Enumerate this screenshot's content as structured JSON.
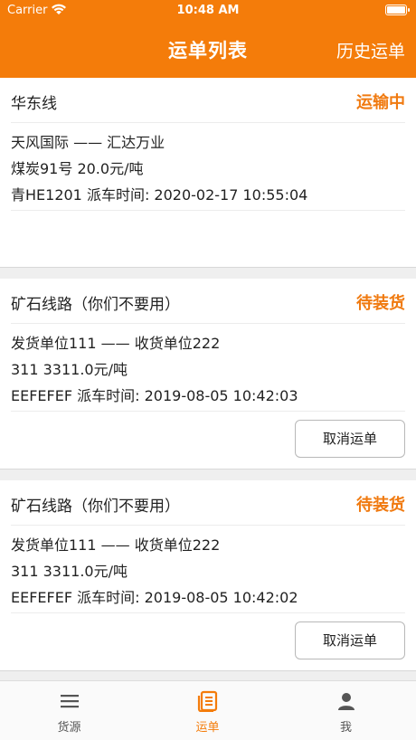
{
  "status_bar": {
    "carrier": "Carrier",
    "time": "10:48 AM"
  },
  "nav": {
    "title": "运单列表",
    "right_action": "历史运单"
  },
  "orders": [
    {
      "route": "华东线",
      "status": "运输中",
      "parties": "天风国际 —— 汇达万业",
      "cargo": "煤炭91号  20.0元/吨",
      "dispatch": "青HE1201  派车时间: 2020-02-17 10:55:04"
    },
    {
      "route": "矿石线路（你们不要用）",
      "status": "待装货",
      "parties": "发货单位111 —— 收货单位222",
      "cargo": "311  3311.0元/吨",
      "dispatch": "EEFEFEF  派车时间: 2019-08-05 10:42:03",
      "action": "取消运单"
    },
    {
      "route": "矿石线路（你们不要用）",
      "status": "待装货",
      "parties": "发货单位111 —— 收货单位222",
      "cargo": "311  3311.0元/吨",
      "dispatch": "EEFEFEF  派车时间: 2019-08-05 10:42:02",
      "action": "取消运单"
    }
  ],
  "tabs": [
    {
      "label": "货源",
      "icon": "menu-icon",
      "active": false
    },
    {
      "label": "运单",
      "icon": "document-list-icon",
      "active": true
    },
    {
      "label": "我",
      "icon": "person-icon",
      "active": false
    }
  ],
  "colors": {
    "accent": "#f47c0a",
    "status": "#f07a10"
  }
}
